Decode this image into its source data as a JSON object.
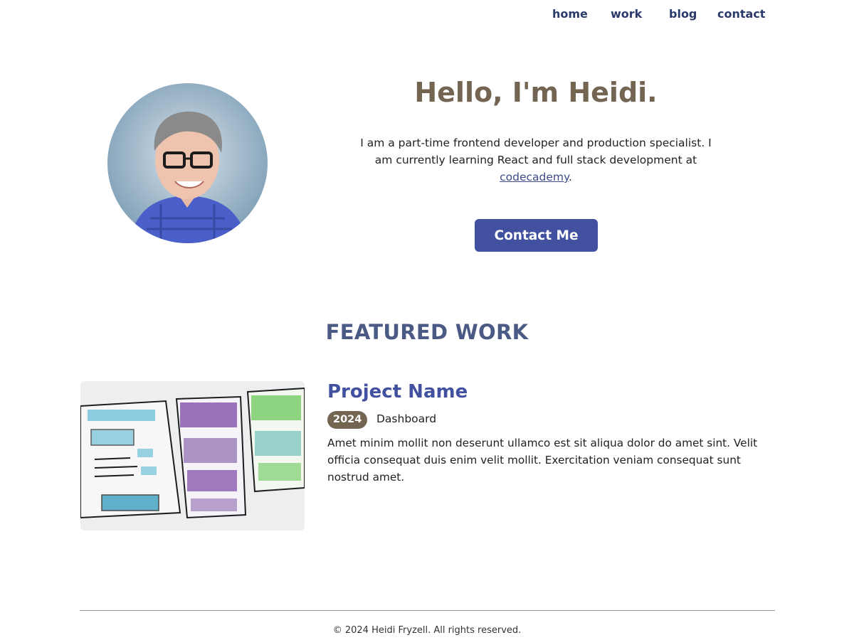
{
  "nav": {
    "home": "home",
    "work": "work",
    "blog": "blog",
    "contact": "contact"
  },
  "hero": {
    "title": "Hello, I'm Heidi.",
    "intro_text": "I am a part-time frontend developer and production specialist. I am currently learning React and full stack development at",
    "link_text": "codecademy",
    "link_suffix": ".",
    "button_label": "Contact Me",
    "avatar_icon": "profile-photo"
  },
  "featured": {
    "title": "FEATURED WORK",
    "project": {
      "name": "Project Name",
      "year": "2024",
      "type": "Dashboard",
      "description": "Amet minim mollit non deserunt ullamco est sit aliqua dolor do amet sint. Velit officia consequat duis enim velit mollit. Exercitation veniam consequat sunt nostrud amet.",
      "image_icon": "wireframe-sketch-image"
    }
  },
  "footer": {
    "text": "© 2024 Heidi Fryzell. All rights reserved."
  },
  "colors": {
    "brand_blue": "#4250a0",
    "nav_text": "#2b3a6b",
    "heading_brown": "#736552",
    "section_title": "#4a5a85"
  }
}
